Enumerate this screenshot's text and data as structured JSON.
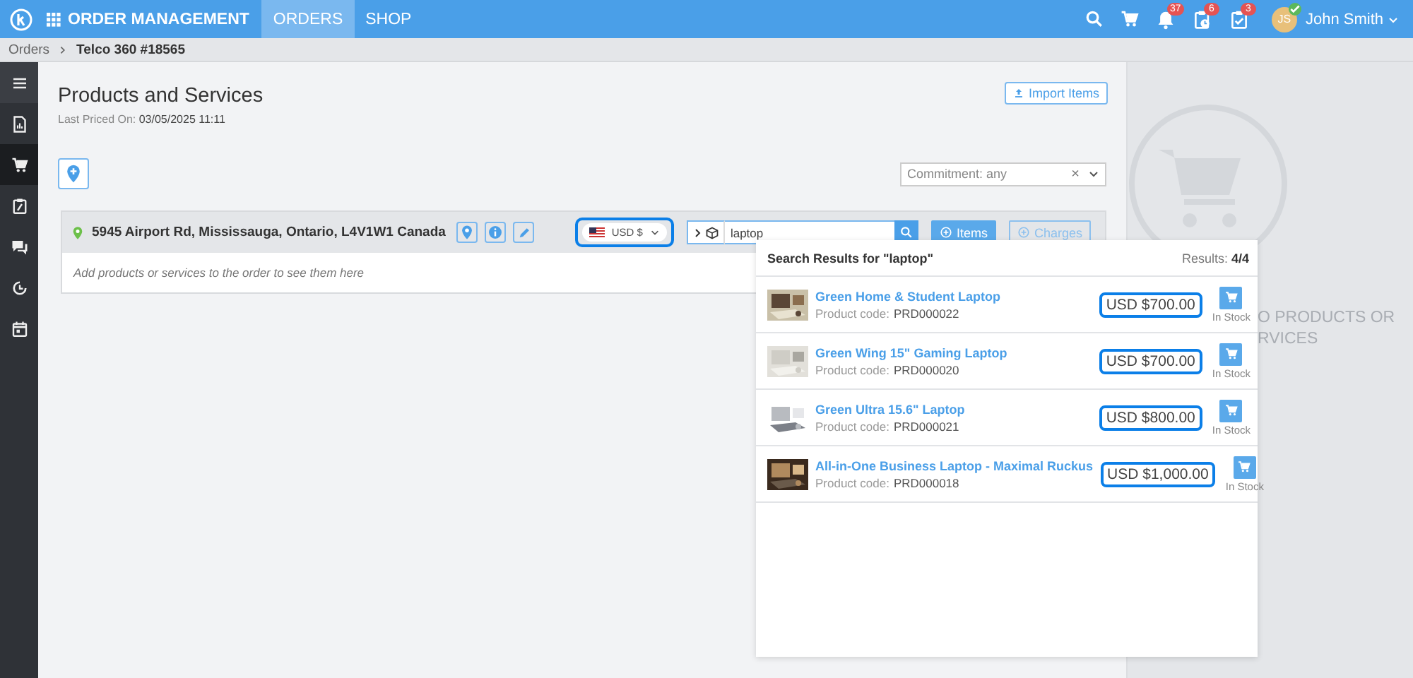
{
  "topbar": {
    "app_title": "ORDER MANAGEMENT",
    "nav": [
      {
        "label": "ORDERS",
        "selected": true
      },
      {
        "label": "SHOP",
        "selected": false
      }
    ],
    "notifications": [
      {
        "kind": "bell",
        "count": "37"
      },
      {
        "kind": "clipboard-clock",
        "count": "6"
      },
      {
        "kind": "clipboard-check",
        "count": "3"
      }
    ],
    "user": {
      "initials": "JS",
      "name": "John Smith",
      "verified": true
    }
  },
  "breadcrumb": [
    {
      "label": "Orders"
    },
    {
      "label": "Telco 360 #18565"
    }
  ],
  "sidebar": {
    "items": [
      {
        "kind": "menu",
        "selected": false
      },
      {
        "kind": "document",
        "selected": false
      },
      {
        "kind": "cart",
        "selected": true
      },
      {
        "kind": "clipboard",
        "selected": false
      },
      {
        "kind": "chat",
        "selected": false
      },
      {
        "kind": "clock",
        "selected": false
      },
      {
        "kind": "calendar",
        "selected": false
      }
    ]
  },
  "page": {
    "title": "Products and Services",
    "last_priced_label": "Last Priced On:",
    "last_priced_value": "03/05/2025 11:11",
    "import_button": "Import Items",
    "commitment": "Commitment: any",
    "clear": "×"
  },
  "location": {
    "address": "5945 Airport Rd, Mississauga, Ontario, L4V1W1 Canada",
    "currency": {
      "label": "USD $",
      "highlighted": true
    },
    "search": {
      "value": "laptop"
    },
    "items_button": "Items",
    "charges_button": "Charges",
    "empty_message": "Add products or services to the order to see them here"
  },
  "results": {
    "title": "Search Results for \"laptop\"",
    "count_label": "Results:",
    "count": "4/4",
    "items": [
      {
        "name": "Green Home & Student Laptop",
        "code_label": "Product code:",
        "code": "PRD000022",
        "price": "USD $700.00",
        "highlighted": true,
        "stock": "In Stock"
      },
      {
        "name": "Green Wing 15\" Gaming Laptop",
        "code_label": "Product code:",
        "code": "PRD000020",
        "price": "USD $700.00",
        "highlighted": true,
        "stock": "In Stock"
      },
      {
        "name": "Green Ultra 15.6\" Laptop",
        "code_label": "Product code:",
        "code": "PRD000021",
        "price": "USD $800.00",
        "highlighted": true,
        "stock": "In Stock"
      },
      {
        "name": "All-in-One Business Laptop - Maximal Ruckus",
        "code_label": "Product code:",
        "code": "PRD000018",
        "price": "USD $1,000.00",
        "highlighted": true,
        "stock": "In Stock"
      }
    ]
  },
  "empty_panel": {
    "lines": [
      "O PRODUCTS OR",
      "RVICES"
    ]
  }
}
